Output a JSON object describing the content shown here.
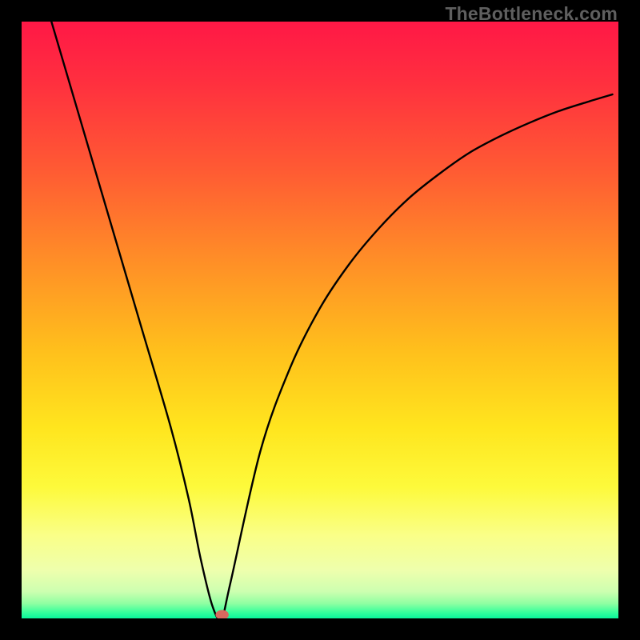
{
  "watermark": "TheBottleneck.com",
  "chart_data": {
    "type": "line",
    "title": "",
    "xlabel": "",
    "ylabel": "",
    "xlim": [
      0,
      100
    ],
    "ylim": [
      0,
      100
    ],
    "gradient_stops": [
      {
        "offset": 0.0,
        "color": "#ff1846"
      },
      {
        "offset": 0.1,
        "color": "#ff2f3f"
      },
      {
        "offset": 0.25,
        "color": "#ff5b33"
      },
      {
        "offset": 0.4,
        "color": "#ff8e27"
      },
      {
        "offset": 0.55,
        "color": "#ffbf1c"
      },
      {
        "offset": 0.68,
        "color": "#ffe51e"
      },
      {
        "offset": 0.78,
        "color": "#fdfa3b"
      },
      {
        "offset": 0.86,
        "color": "#faff87"
      },
      {
        "offset": 0.92,
        "color": "#eeffad"
      },
      {
        "offset": 0.955,
        "color": "#cdffb0"
      },
      {
        "offset": 0.975,
        "color": "#8fffa2"
      },
      {
        "offset": 0.99,
        "color": "#35ff9c"
      },
      {
        "offset": 1.0,
        "color": "#09f59b"
      }
    ],
    "series": [
      {
        "name": "curve",
        "x": [
          5,
          10,
          15,
          20,
          25,
          28,
          30,
          32,
          33.5,
          35,
          40,
          45,
          50,
          55,
          60,
          65,
          70,
          75,
          80,
          85,
          90,
          95,
          99
        ],
        "y": [
          100,
          83,
          66,
          49,
          32,
          20,
          10,
          2,
          0,
          6,
          28,
          42,
          52,
          59.5,
          65.5,
          70.5,
          74.5,
          78,
          80.7,
          83,
          85,
          86.6,
          87.8
        ]
      }
    ],
    "marker": {
      "x": 33.6,
      "y": 0.6,
      "rx": 1.1,
      "ry": 0.8,
      "color": "#d8695f"
    }
  }
}
